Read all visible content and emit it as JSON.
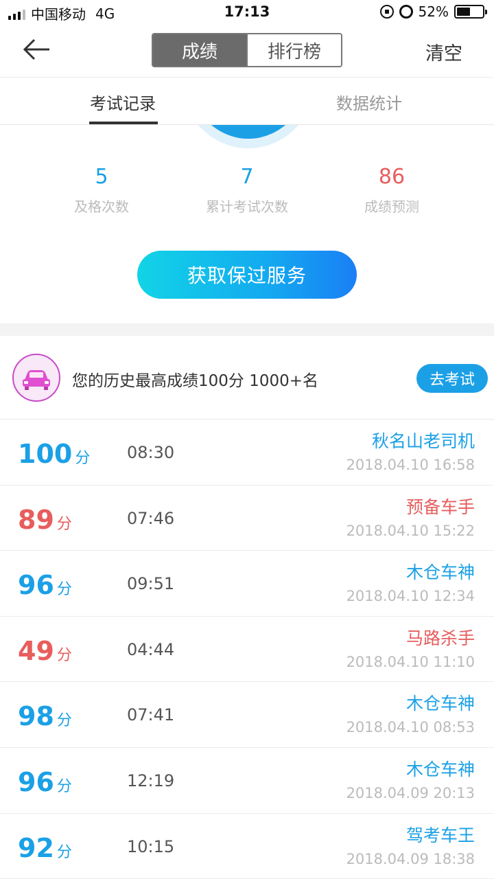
{
  "status_bar": {
    "carrier": "中国移动",
    "network": "4G",
    "time": "17:13",
    "battery": "52%",
    "battery_level": 0.52
  },
  "nav": {
    "back_icon": "back-arrow-icon",
    "segments": [
      "成绩",
      "排行榜"
    ],
    "active_segment": 0,
    "clear_label": "清空"
  },
  "tabs": {
    "items": [
      "考试记录",
      "数据统计"
    ],
    "active": 0
  },
  "summary": {
    "stats": [
      {
        "value": "5",
        "label": "及格次数",
        "color": "#1ba0e6"
      },
      {
        "value": "7",
        "label": "累计考试次数",
        "color": "#1ba0e6"
      },
      {
        "value": "86",
        "label": "成绩预测",
        "color": "#e85d5d"
      }
    ],
    "cta_label": "获取保过服务"
  },
  "best": {
    "avatar_icon": "car-icon",
    "text": "您的历史最高成绩100分 1000+名",
    "button_label": "去考试"
  },
  "records": [
    {
      "score": "100",
      "unit": "分",
      "duration": "08:30",
      "title": "秋名山老司机",
      "date": "2018.04.10 16:58",
      "color": "#1ba0e6"
    },
    {
      "score": "89",
      "unit": "分",
      "duration": "07:46",
      "title": "预备车手",
      "date": "2018.04.10 15:22",
      "color": "#e85d5d"
    },
    {
      "score": "96",
      "unit": "分",
      "duration": "09:51",
      "title": "木仓车神",
      "date": "2018.04.10 12:34",
      "color": "#1ba0e6"
    },
    {
      "score": "49",
      "unit": "分",
      "duration": "04:44",
      "title": "马路杀手",
      "date": "2018.04.10 11:10",
      "color": "#e85d5d"
    },
    {
      "score": "98",
      "unit": "分",
      "duration": "07:41",
      "title": "木仓车神",
      "date": "2018.04.10 08:53",
      "color": "#1ba0e6"
    },
    {
      "score": "96",
      "unit": "分",
      "duration": "12:19",
      "title": "木仓车神",
      "date": "2018.04.09 20:13",
      "color": "#1ba0e6"
    },
    {
      "score": "92",
      "unit": "分",
      "duration": "10:15",
      "title": "驾考车王",
      "date": "2018.04.09 18:38",
      "color": "#1ba0e6"
    }
  ]
}
